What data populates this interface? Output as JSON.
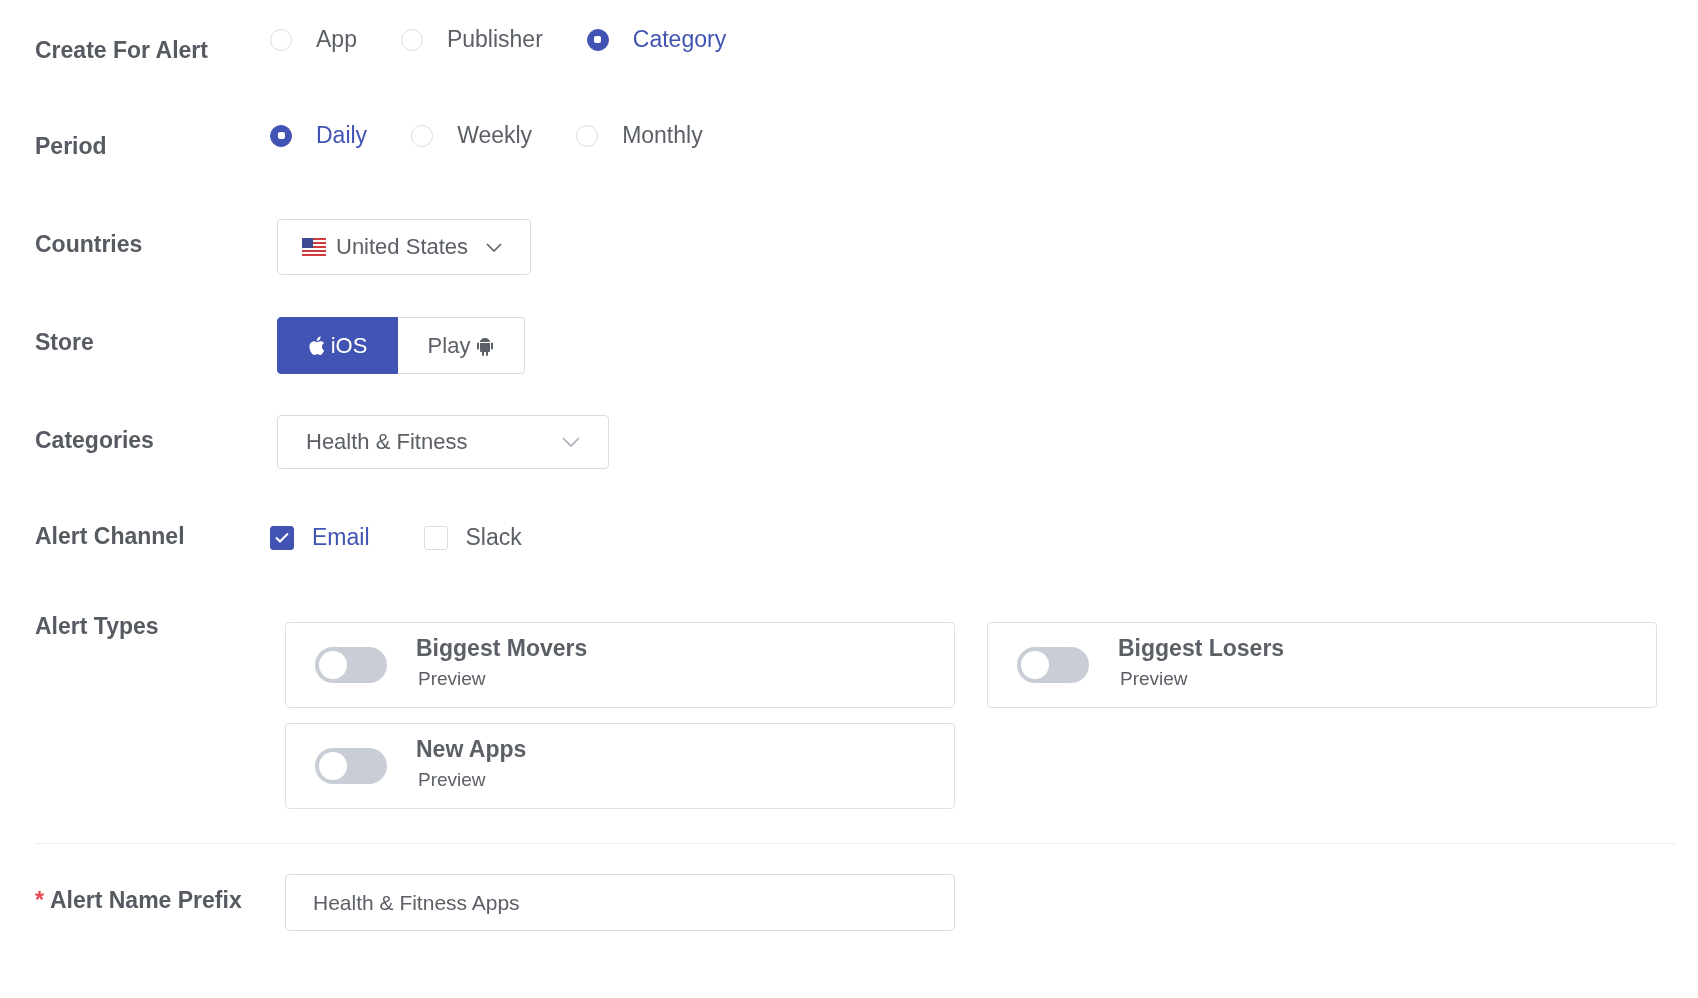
{
  "create_for_alert": {
    "label": "Create For Alert",
    "options": [
      {
        "label": "App",
        "selected": false
      },
      {
        "label": "Publisher",
        "selected": false
      },
      {
        "label": "Category",
        "selected": true
      }
    ]
  },
  "period": {
    "label": "Period",
    "options": [
      {
        "label": "Daily",
        "selected": true
      },
      {
        "label": "Weekly",
        "selected": false
      },
      {
        "label": "Monthly",
        "selected": false
      }
    ]
  },
  "countries": {
    "label": "Countries",
    "value": "United States"
  },
  "store": {
    "label": "Store",
    "options": [
      {
        "label": "iOS",
        "kind": "ios",
        "selected": true
      },
      {
        "label": "Play",
        "kind": "play",
        "selected": false
      }
    ]
  },
  "categories": {
    "label": "Categories",
    "value": "Health & Fitness"
  },
  "alert_channel": {
    "label": "Alert Channel",
    "options": [
      {
        "label": "Email",
        "checked": true
      },
      {
        "label": "Slack",
        "checked": false
      }
    ]
  },
  "alert_types": {
    "label": "Alert Types",
    "items": [
      {
        "title": "Biggest Movers",
        "link": "Preview",
        "on": false
      },
      {
        "title": "Biggest Losers",
        "link": "Preview",
        "on": false
      },
      {
        "title": "New Apps",
        "link": "Preview",
        "on": false
      }
    ]
  },
  "alert_name_prefix": {
    "label": "Alert Name Prefix",
    "required_mark": "*",
    "value": "Health & Fitness Apps"
  }
}
